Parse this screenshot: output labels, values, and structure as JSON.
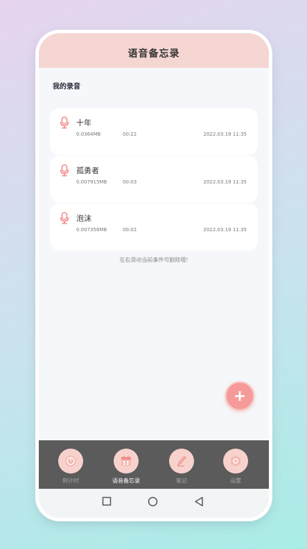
{
  "app": {
    "title": "语音备忘录"
  },
  "section": {
    "title": "我的录音"
  },
  "recordings": [
    {
      "name": "十年",
      "size": "0.0364MB",
      "duration": "00:22",
      "time": "2022.03.19  11:35"
    },
    {
      "name": "孤勇者",
      "size": "0.007915MB",
      "duration": "00:03",
      "time": "2022.03.19  11:35"
    },
    {
      "name": "泡沫",
      "size": "0.007356MB",
      "duration": "00:02",
      "time": "2022.03.19  11:35"
    }
  ],
  "hint": "左右滑动当前事件可删除哦!",
  "fab": {
    "label": "+"
  },
  "tabs": [
    {
      "label": "倒计时",
      "icon": "timer-icon",
      "active": false
    },
    {
      "label": "语音备忘录",
      "icon": "calendar-icon",
      "active": true
    },
    {
      "label": "笔记",
      "icon": "pen-icon",
      "active": false
    },
    {
      "label": "设置",
      "icon": "settings-icon",
      "active": false
    }
  ],
  "colors": {
    "header": "#f5d6d2",
    "accent": "#f59a98",
    "mic_icon": "#f08c8a",
    "tabbar": "#5b5b5b",
    "tab_circle": "#f7d2cd"
  },
  "system_nav": [
    "square-icon",
    "circle-icon",
    "triangle-icon"
  ]
}
